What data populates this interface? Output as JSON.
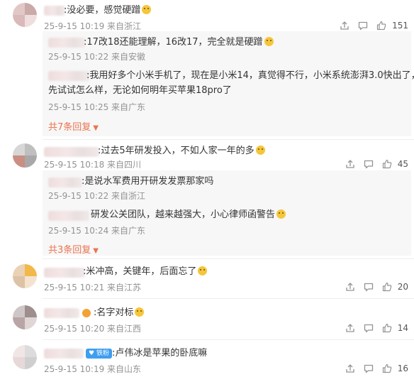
{
  "comments": [
    {
      "text": ":没必要，感觉硬蹭",
      "meta": "25-9-15 10:19 来自浙江",
      "like_count": "151",
      "replies": [
        {
          "text": ":17改18还能理解，16改17，完全就是硬蹭",
          "meta": "25-9-15 10:22 来自安徽"
        },
        {
          "text": ":我用好多个小米手机了，现在是小米14，真觉得不行，小米系统澎湃3.0快出了，",
          "text2": "先试试怎么样，无论如何明年买苹果18pro了",
          "meta": "25-9-15 10:25 来自广东"
        }
      ],
      "more": "共7条回复"
    },
    {
      "text": ":过去5年研发投入，不如人家一年的多",
      "meta": "25-9-15 10:18 来自四川",
      "like_count": "45",
      "replies": [
        {
          "text": ":是说水军费用开研发发票那家吗",
          "meta": "25-9-15 10:22 来自浙江"
        },
        {
          "text": "研发公关团队，越来越强大，小心律师函警告",
          "meta": "25-9-15 10:24 来自广东"
        }
      ],
      "more": "共3条回复"
    },
    {
      "text": ":米冲高，关键年，后面忘了",
      "meta": "25-9-15 10:21 来自江苏",
      "like_count": "20"
    },
    {
      "text": ":名字对标",
      "meta": "25-9-15 10:20 来自江西",
      "like_count": "14"
    },
    {
      "text": ":卢伟冰是苹果的卧底嘛",
      "meta": "25-9-15 10:19 来自山东",
      "like_count": "16",
      "badge": "铁粉"
    }
  ],
  "icons": {
    "share": "share-icon",
    "comment": "comment-icon",
    "like": "like-icon"
  },
  "colors": {
    "accent": "#eb7350",
    "meta": "#939393"
  }
}
